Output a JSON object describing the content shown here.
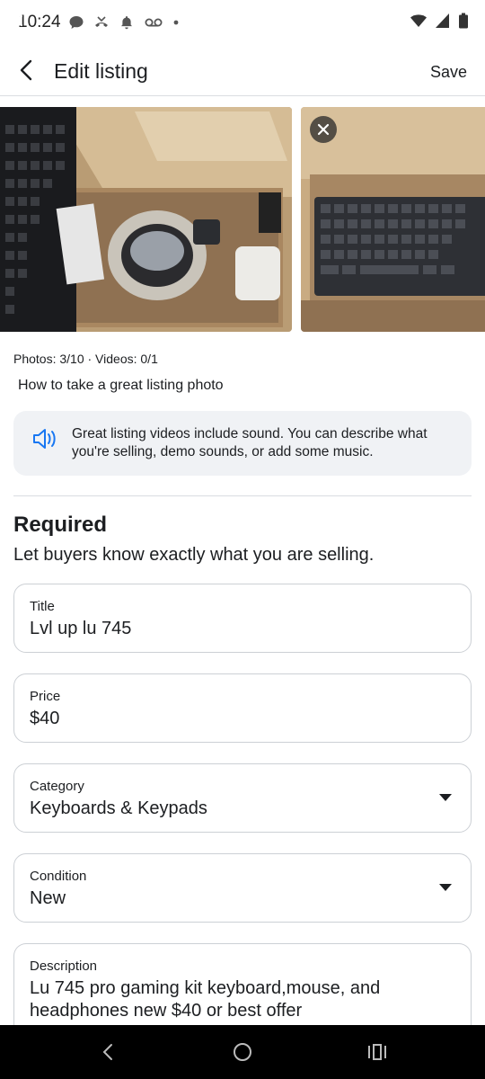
{
  "status": {
    "time": "10:24"
  },
  "header": {
    "title": "Edit listing",
    "save_label": "Save"
  },
  "media": {
    "counts": "Photos: 3/10 · Videos: 0/1",
    "tip_link": "How to take a great listing photo"
  },
  "tip": {
    "text": "Great listing videos include sound. You can describe what you're selling, demo sounds, or add some music."
  },
  "required": {
    "title": "Required",
    "subtitle": "Let buyers know exactly what you are selling."
  },
  "fields": {
    "title": {
      "label": "Title",
      "value": "Lvl up lu 745"
    },
    "price": {
      "label": "Price",
      "value": "$40"
    },
    "category": {
      "label": "Category",
      "value": "Keyboards & Keypads"
    },
    "condition": {
      "label": "Condition",
      "value": "New"
    },
    "description": {
      "label": "Description",
      "value": "Lu 745 pro gaming kit keyboard,mouse, and headphones new $40 or best offer"
    }
  },
  "colors": {
    "accent": "#1877f2",
    "tip_bg": "#f0f2f5",
    "border": "#ccd0d5"
  }
}
